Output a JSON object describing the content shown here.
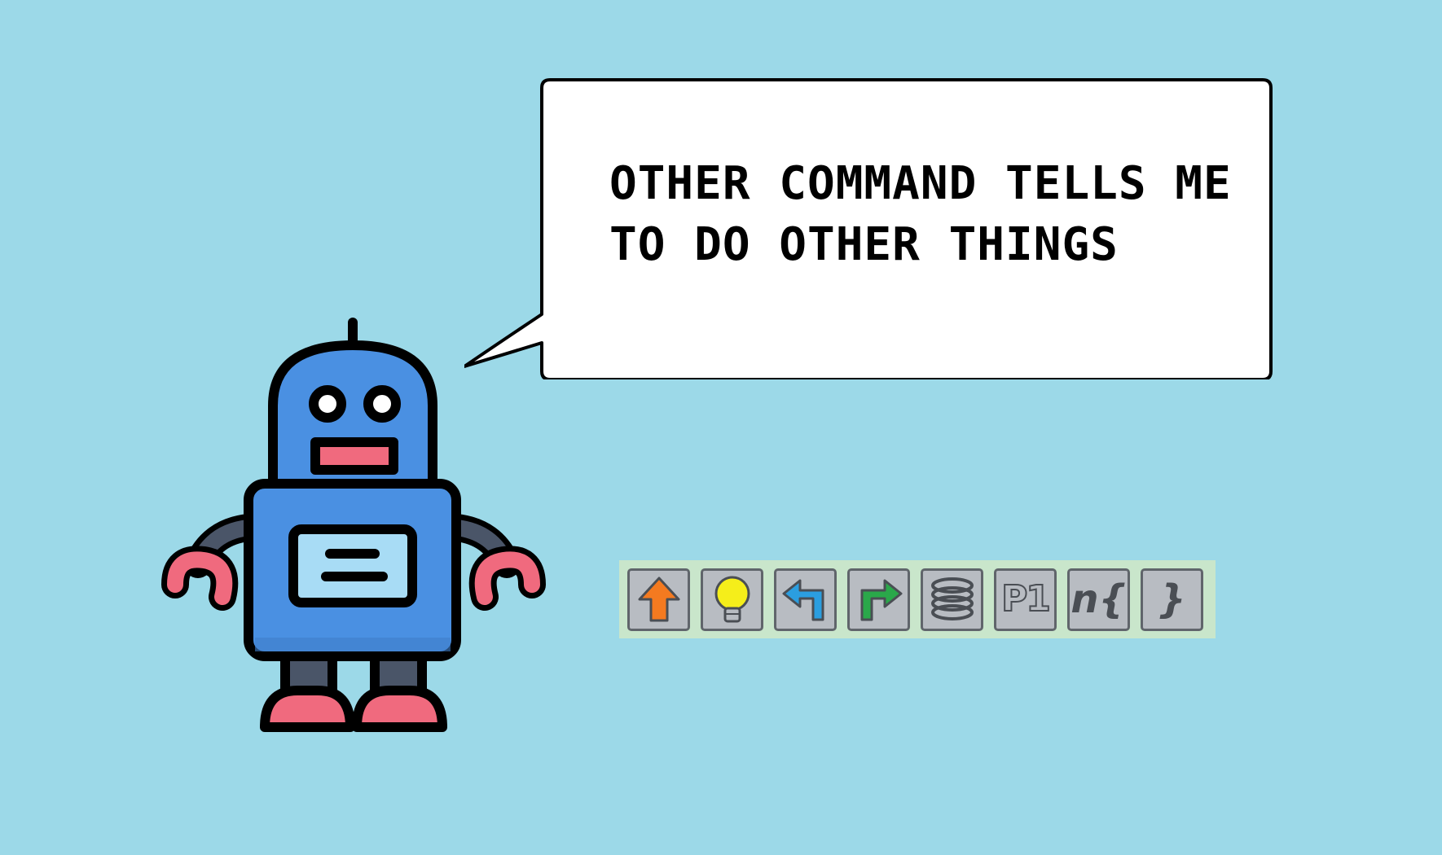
{
  "speech": {
    "text": "OTHER COMMAND TELLS ME\nTO DO OTHER THINGS"
  },
  "colors": {
    "background": "#9cd9e8",
    "robot_body": "#4a90e2",
    "robot_outline": "#000000",
    "accent_pink": "#f06a7e",
    "screen_light": "#a8dcf5",
    "limb_gray": "#4a5568"
  },
  "toolbar": {
    "commands": [
      {
        "name": "forward",
        "icon": "up-arrow-icon"
      },
      {
        "name": "light",
        "icon": "lightbulb-icon"
      },
      {
        "name": "turn-left",
        "icon": "turn-left-icon"
      },
      {
        "name": "turn-right",
        "icon": "turn-right-icon"
      },
      {
        "name": "spring",
        "icon": "spring-icon"
      },
      {
        "name": "procedure-1",
        "label": "P1",
        "icon": "procedure-icon"
      },
      {
        "name": "repeat",
        "label": "n{",
        "icon": "repeat-icon"
      },
      {
        "name": "end-block",
        "label": "}",
        "icon": "close-brace-icon"
      }
    ]
  }
}
